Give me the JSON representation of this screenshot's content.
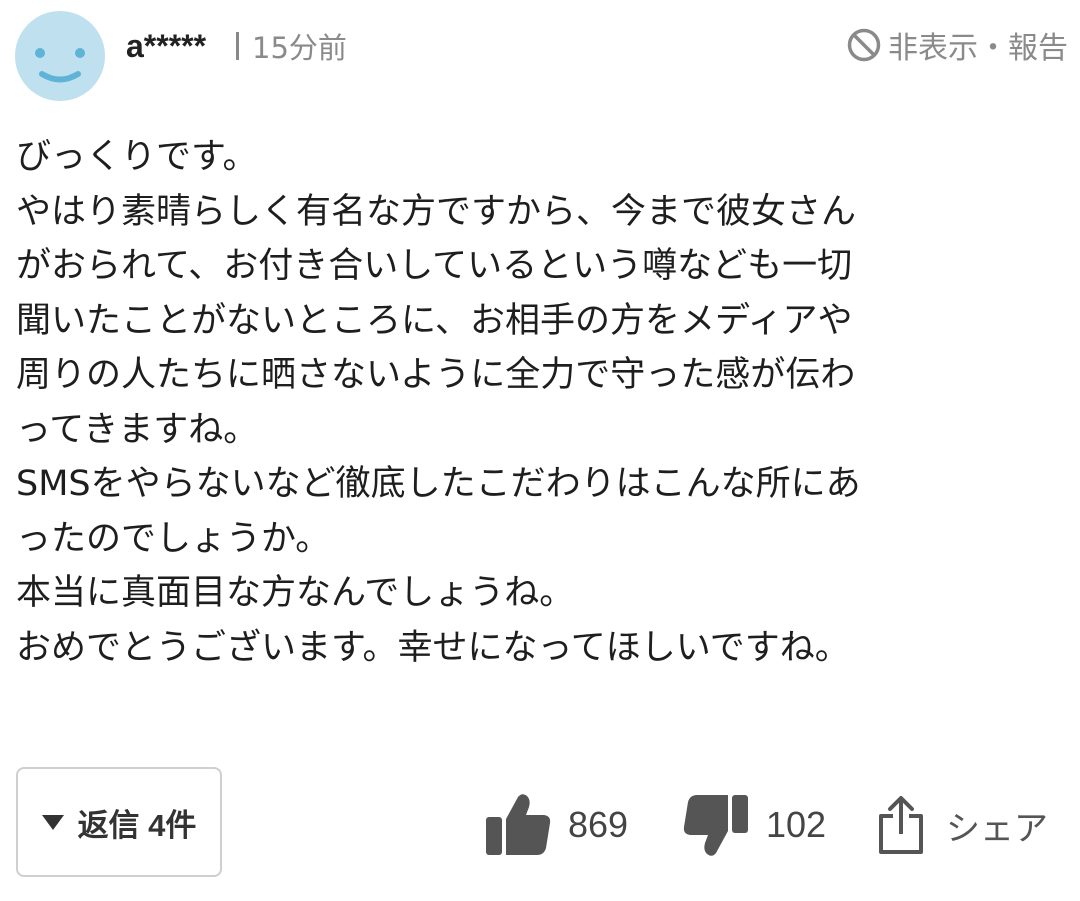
{
  "comment": {
    "username": "a*****",
    "time": "15分前",
    "report_label": "非表示・報告",
    "icons": {
      "avatar": "smiley-face-icon",
      "report": "block-icon",
      "like": "thumbs-up-icon",
      "dislike": "thumbs-down-icon",
      "share": "share-icon",
      "reply": "caret-down-icon"
    },
    "lines": [
      "びっくりです。",
      "やはり素晴らしく有名な方ですから、今まで彼女さん",
      "がおられて、お付き合いしているという噂なども一切",
      "聞いたことがないところに、お相手の方をメディアや",
      "周りの人たちに晒さないように全力で守った感が伝わ",
      "ってきますね。",
      "SMSをやらないなど徹底したこだわりはこんな所にあ",
      "ったのでしょうか。",
      "本当に真面目な方なんでしょうね。",
      "おめでとうございます。幸せになってほしいですね。"
    ],
    "reply_label": "返信 4件",
    "likes": "869",
    "dislikes": "102",
    "share_label": "シェア"
  },
  "colors": {
    "avatar_bg": "#bfe0ee",
    "avatar_face": "#5fb3d6",
    "muted_text": "#8a8a8a",
    "icon_gray": "#555555",
    "body_text": "#1e1e1e"
  }
}
